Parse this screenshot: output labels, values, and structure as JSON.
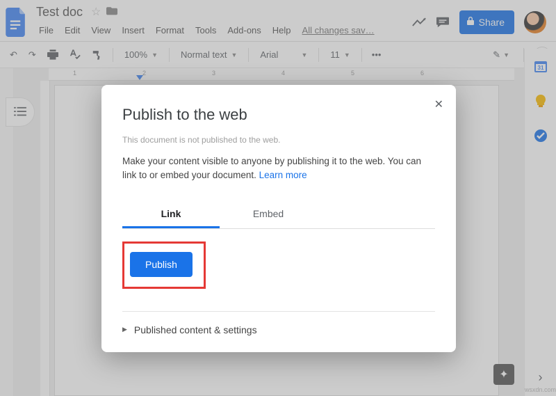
{
  "header": {
    "doc_title": "Test doc",
    "menus": [
      "File",
      "Edit",
      "View",
      "Insert",
      "Format",
      "Tools",
      "Add-ons",
      "Help"
    ],
    "save_status": "All changes sav…",
    "share_label": "Share"
  },
  "toolbar": {
    "zoom": "100%",
    "style": "Normal text",
    "font": "Arial",
    "size": "11"
  },
  "ruler": {
    "ticks": [
      1,
      2,
      3,
      4,
      5,
      6
    ]
  },
  "dialog": {
    "title": "Publish to the web",
    "status": "This document is not published to the web.",
    "description_pre": "Make your content visible to anyone by publishing it to the web. You can link to or embed your document. ",
    "learn_more": "Learn more",
    "tabs": {
      "link": "Link",
      "embed": "Embed"
    },
    "publish_label": "Publish",
    "expand_label": "Published content & settings"
  },
  "footer": {
    "watermark": "wsxdn.com"
  }
}
